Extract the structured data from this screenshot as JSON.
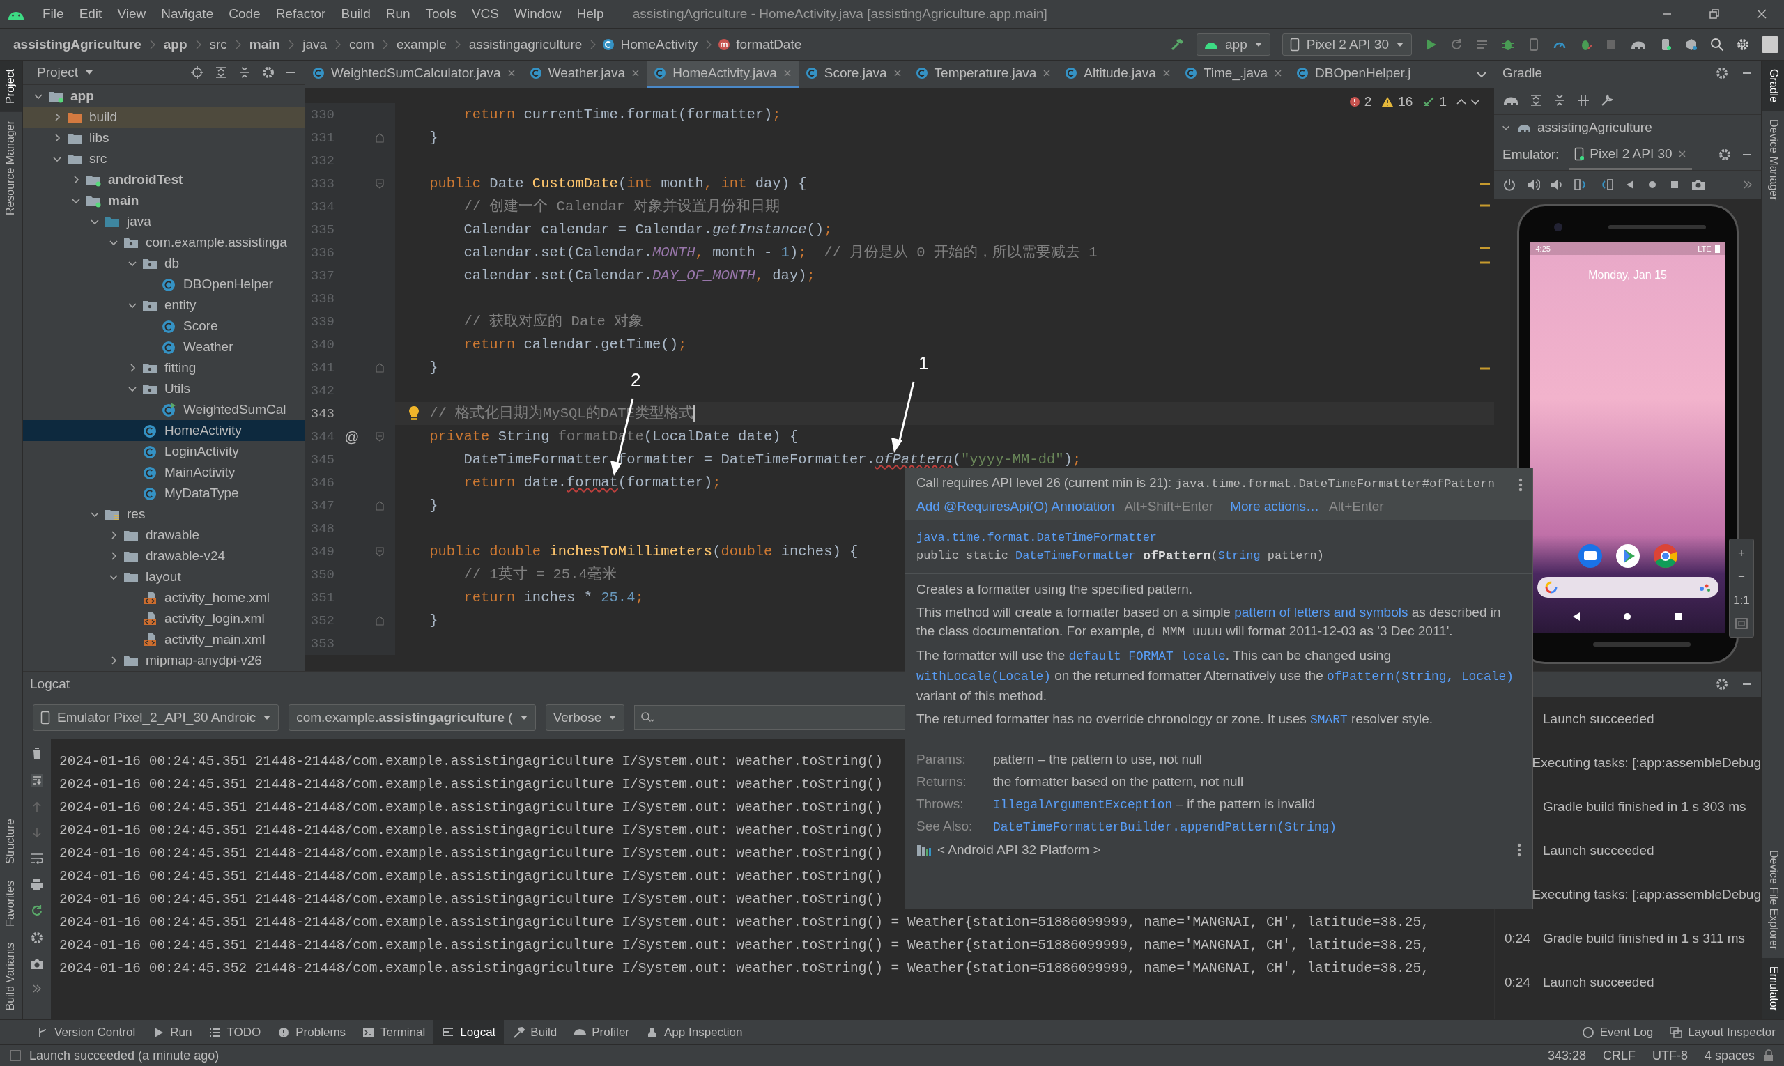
{
  "title_bar": {
    "menus": [
      "File",
      "Edit",
      "View",
      "Navigate",
      "Code",
      "Refactor",
      "Build",
      "Run",
      "Tools",
      "VCS",
      "Window",
      "Help"
    ],
    "title": "assistingAgriculture - HomeActivity.java [assistingAgriculture.app.main]"
  },
  "nav_bar": {
    "breadcrumbs": [
      {
        "label": "assistingAgriculture",
        "bold": true,
        "kind": "plain"
      },
      {
        "label": "app",
        "bold": true,
        "kind": "plain"
      },
      {
        "label": "src",
        "bold": false,
        "kind": "plain"
      },
      {
        "label": "main",
        "bold": true,
        "kind": "plain"
      },
      {
        "label": "java",
        "bold": false,
        "kind": "plain"
      },
      {
        "label": "com",
        "bold": false,
        "kind": "plain"
      },
      {
        "label": "example",
        "bold": false,
        "kind": "plain"
      },
      {
        "label": "assistingagriculture",
        "bold": false,
        "kind": "plain"
      },
      {
        "label": "HomeActivity",
        "bold": false,
        "kind": "class"
      },
      {
        "label": "formatDate",
        "bold": false,
        "kind": "method"
      }
    ],
    "run_config": "app",
    "device": "Pixel 2 API 30"
  },
  "left_strip": {
    "top": [
      {
        "label": "Project",
        "selected": true
      },
      {
        "label": "Resource Manager",
        "selected": false
      }
    ],
    "bottom": [
      {
        "label": "Structure",
        "selected": false
      },
      {
        "label": "Favorites",
        "selected": false
      },
      {
        "label": "Build Variants",
        "selected": false
      }
    ]
  },
  "right_strip": {
    "top": [
      {
        "label": "Gradle",
        "selected": true
      },
      {
        "label": "Device Manager",
        "selected": false
      }
    ],
    "bottom": [
      {
        "label": "Device File Explorer",
        "selected": false
      },
      {
        "label": "Emulator",
        "selected": true
      }
    ]
  },
  "project_panel": {
    "title": "Project",
    "tree": [
      {
        "label": "app",
        "kind": "module",
        "bold": true,
        "expanded": true,
        "selected": false,
        "children": [
          {
            "label": "build",
            "kind": "excluded",
            "bold": false,
            "expanded": false,
            "selected": false
          },
          {
            "label": "libs",
            "kind": "folder",
            "bold": false,
            "expanded": false,
            "selected": false
          },
          {
            "label": "src",
            "kind": "folder",
            "bold": false,
            "expanded": true,
            "selected": false,
            "children": [
              {
                "label": "androidTest",
                "kind": "module",
                "bold": true,
                "expanded": false,
                "selected": false
              },
              {
                "label": "main",
                "kind": "module",
                "bold": true,
                "expanded": true,
                "selected": false,
                "children": [
                  {
                    "label": "java",
                    "kind": "source",
                    "bold": false,
                    "expanded": true,
                    "selected": false,
                    "children": [
                      {
                        "label": "com.example.assistinga",
                        "kind": "package",
                        "bold": false,
                        "expanded": true,
                        "selected": false,
                        "children": [
                          {
                            "label": "db",
                            "kind": "package",
                            "bold": false,
                            "expanded": true,
                            "selected": false,
                            "children": [
                              {
                                "label": "DBOpenHelper",
                                "kind": "class",
                                "bold": false,
                                "selected": false
                              }
                            ]
                          },
                          {
                            "label": "entity",
                            "kind": "package",
                            "bold": false,
                            "expanded": true,
                            "selected": false,
                            "children": [
                              {
                                "label": "Score",
                                "kind": "class",
                                "bold": false,
                                "selected": false
                              },
                              {
                                "label": "Weather",
                                "kind": "class",
                                "bold": false,
                                "selected": false
                              }
                            ]
                          },
                          {
                            "label": "fitting",
                            "kind": "package",
                            "bold": false,
                            "expanded": false,
                            "selected": false
                          },
                          {
                            "label": "Utils",
                            "kind": "package",
                            "bold": false,
                            "expanded": true,
                            "selected": false,
                            "children": [
                              {
                                "label": "WeightedSumCal",
                                "kind": "runnable",
                                "bold": false,
                                "selected": false
                              }
                            ]
                          },
                          {
                            "label": "HomeActivity",
                            "kind": "class",
                            "bold": false,
                            "selected": true
                          },
                          {
                            "label": "LoginActivity",
                            "kind": "class",
                            "bold": false,
                            "selected": false
                          },
                          {
                            "label": "MainActivity",
                            "kind": "class",
                            "bold": false,
                            "selected": false
                          },
                          {
                            "label": "MyDataType",
                            "kind": "class",
                            "bold": false,
                            "selected": false
                          }
                        ]
                      }
                    ]
                  },
                  {
                    "label": "res",
                    "kind": "resources",
                    "bold": false,
                    "expanded": true,
                    "selected": false,
                    "children": [
                      {
                        "label": "drawable",
                        "kind": "folder",
                        "bold": false,
                        "expanded": false,
                        "selected": false
                      },
                      {
                        "label": "drawable-v24",
                        "kind": "folder",
                        "bold": false,
                        "expanded": false,
                        "selected": false
                      },
                      {
                        "label": "layout",
                        "kind": "folder",
                        "bold": false,
                        "expanded": true,
                        "selected": false,
                        "children": [
                          {
                            "label": "activity_home.xml",
                            "kind": "layout",
                            "bold": false,
                            "selected": false
                          },
                          {
                            "label": "activity_login.xml",
                            "kind": "layout",
                            "bold": false,
                            "selected": false
                          },
                          {
                            "label": "activity_main.xml",
                            "kind": "layout",
                            "bold": false,
                            "selected": false
                          }
                        ]
                      },
                      {
                        "label": "mipmap-anydpi-v26",
                        "kind": "folder",
                        "bold": false,
                        "expanded": false,
                        "selected": false
                      }
                    ]
                  }
                ]
              }
            ]
          }
        ]
      }
    ]
  },
  "editor_tabs": [
    {
      "label": "WeightedSumCalculator.java",
      "selected": false,
      "closable": true
    },
    {
      "label": "Weather.java",
      "selected": false,
      "closable": true
    },
    {
      "label": "HomeActivity.java",
      "selected": true,
      "closable": true
    },
    {
      "label": "Score.java",
      "selected": false,
      "closable": true
    },
    {
      "label": "Temperature.java",
      "selected": false,
      "closable": true
    },
    {
      "label": "Altitude.java",
      "selected": false,
      "closable": true
    },
    {
      "label": "Time_.java",
      "selected": false,
      "closable": true
    },
    {
      "label": "DBOpenHelper.j",
      "selected": false,
      "closable": false
    }
  ],
  "inspections": {
    "errors": "2",
    "warnings": "16",
    "weak_warnings": "1"
  },
  "code_lines": [
    {
      "number": "330",
      "kind": "plain",
      "current": false,
      "tokens": [
        {
          "kind": "keyword",
          "text": "        return "
        },
        {
          "kind": "plain",
          "text": "currentTime.format(formatter)"
        },
        {
          "kind": "keyword",
          "text": ";"
        }
      ]
    },
    {
      "number": "331",
      "kind": "block-end",
      "current": false,
      "tokens": [
        {
          "kind": "plain",
          "text": "    }"
        }
      ]
    },
    {
      "number": "332",
      "kind": "plain",
      "current": false
    },
    {
      "number": "333",
      "kind": "block-start",
      "current": false,
      "tokens": [
        {
          "kind": "keyword",
          "text": "    public "
        },
        {
          "kind": "plain",
          "text": "Date "
        },
        {
          "kind": "declaration",
          "text": "CustomDate"
        },
        {
          "kind": "plain",
          "text": "("
        },
        {
          "kind": "keyword",
          "text": "int "
        },
        {
          "kind": "plain",
          "text": "month"
        },
        {
          "kind": "keyword",
          "text": ", int "
        },
        {
          "kind": "plain",
          "text": "day) {"
        }
      ]
    },
    {
      "number": "334",
      "kind": "plain",
      "current": false,
      "tokens": [
        {
          "kind": "comment",
          "text": "        // 创建一个 Calendar 对象并设置月份和日期"
        }
      ]
    },
    {
      "number": "335",
      "kind": "plain",
      "current": false,
      "tokens": [
        {
          "kind": "plain",
          "text": "        Calendar calendar = Calendar."
        },
        {
          "kind": "call",
          "text": "getInstance"
        },
        {
          "kind": "plain",
          "text": "()"
        },
        {
          "kind": "keyword",
          "text": ";"
        }
      ]
    },
    {
      "number": "336",
      "kind": "plain",
      "current": false,
      "tokens": [
        {
          "kind": "plain",
          "text": "        calendar.set(Calendar."
        },
        {
          "kind": "constant",
          "text": "MONTH"
        },
        {
          "kind": "keyword",
          "text": ", "
        },
        {
          "kind": "plain",
          "text": "month - "
        },
        {
          "kind": "number",
          "text": "1"
        },
        {
          "kind": "plain",
          "text": ")"
        },
        {
          "kind": "keyword",
          "text": ";"
        },
        {
          "kind": "comment",
          "text": "  // 月份是从 0 开始的，所以需要减去 1"
        }
      ]
    },
    {
      "number": "337",
      "kind": "plain",
      "current": false,
      "tokens": [
        {
          "kind": "plain",
          "text": "        calendar.set(Calendar."
        },
        {
          "kind": "constant",
          "text": "DAY_OF_MONTH"
        },
        {
          "kind": "keyword",
          "text": ", "
        },
        {
          "kind": "plain",
          "text": "day)"
        },
        {
          "kind": "keyword",
          "text": ";"
        }
      ]
    },
    {
      "number": "338",
      "kind": "plain",
      "current": false
    },
    {
      "number": "339",
      "kind": "plain",
      "current": false,
      "tokens": [
        {
          "kind": "comment",
          "text": "        // 获取对应的 Date 对象"
        }
      ]
    },
    {
      "number": "340",
      "kind": "plain",
      "current": false,
      "tokens": [
        {
          "kind": "keyword",
          "text": "        return "
        },
        {
          "kind": "plain",
          "text": "calendar.getTime()"
        },
        {
          "kind": "keyword",
          "text": ";"
        }
      ]
    },
    {
      "number": "341",
      "kind": "block-end",
      "current": false,
      "tokens": [
        {
          "kind": "plain",
          "text": "    }"
        }
      ]
    },
    {
      "number": "342",
      "kind": "plain",
      "current": false
    },
    {
      "number": "343",
      "kind": "plain",
      "current": true,
      "bulb": true,
      "tokens": [
        {
          "kind": "comment",
          "text": "    // 格式化日期为MySQL的DATE类型格式"
        }
      ]
    },
    {
      "number": "344",
      "kind": "block-start",
      "current": false,
      "gutter_mark": "@",
      "tokens": [
        {
          "kind": "keyword",
          "text": "    private "
        },
        {
          "kind": "plain",
          "text": "String "
        },
        {
          "kind": "unused",
          "text": "formatDate"
        },
        {
          "kind": "plain",
          "text": "(LocalDate date) {"
        }
      ]
    },
    {
      "number": "345",
      "kind": "plain",
      "current": false,
      "tokens": [
        {
          "kind": "plain",
          "text": "        DateTimeFormatter formatter = DateTimeFormatter."
        },
        {
          "kind": "error-call",
          "text": "ofPattern"
        },
        {
          "kind": "plain",
          "text": "("
        },
        {
          "kind": "string",
          "text": "\"yyyy-MM-dd\""
        },
        {
          "kind": "plain",
          "text": ")"
        },
        {
          "kind": "keyword",
          "text": ";"
        }
      ]
    },
    {
      "number": "346",
      "kind": "plain",
      "current": false,
      "tokens": [
        {
          "kind": "keyword",
          "text": "        return "
        },
        {
          "kind": "plain",
          "text": "date."
        },
        {
          "kind": "error",
          "text": "format"
        },
        {
          "kind": "plain",
          "text": "(formatter)"
        },
        {
          "kind": "keyword",
          "text": ";"
        }
      ]
    },
    {
      "number": "347",
      "kind": "block-end",
      "current": false,
      "tokens": [
        {
          "kind": "plain",
          "text": "    }"
        }
      ]
    },
    {
      "number": "348",
      "kind": "plain",
      "current": false
    },
    {
      "number": "349",
      "kind": "block-start",
      "current": false,
      "tokens": [
        {
          "kind": "keyword",
          "text": "    public double "
        },
        {
          "kind": "declaration",
          "text": "inchesToMillimeters"
        },
        {
          "kind": "plain",
          "text": "("
        },
        {
          "kind": "keyword",
          "text": "double "
        },
        {
          "kind": "plain",
          "text": "inches) {"
        }
      ]
    },
    {
      "number": "350",
      "kind": "plain",
      "current": false,
      "tokens": [
        {
          "kind": "comment",
          "text": "        // 1英寸 = 25.4毫米"
        }
      ]
    },
    {
      "number": "351",
      "kind": "plain",
      "current": false,
      "tokens": [
        {
          "kind": "keyword",
          "text": "        return "
        },
        {
          "kind": "plain",
          "text": "inches * "
        },
        {
          "kind": "number",
          "text": "25.4"
        },
        {
          "kind": "keyword",
          "text": ";"
        }
      ]
    },
    {
      "number": "352",
      "kind": "block-end",
      "current": false,
      "tokens": [
        {
          "kind": "plain",
          "text": "    }"
        }
      ]
    },
    {
      "number": "353",
      "kind": "plain",
      "current": false
    }
  ],
  "annotations": [
    {
      "label": "1"
    },
    {
      "label": "2"
    }
  ],
  "tooltip": {
    "problem": [
      {
        "kind": "text",
        "text": "Call requires API level 26 (current min is 21): "
      },
      {
        "kind": "code",
        "text": "java.time.format.DateTimeFormatter#ofPattern"
      }
    ],
    "actions": [
      {
        "label": "Add @RequiresApi(O) Annotation",
        "shortcut": "Alt+Shift+Enter"
      },
      {
        "label": "More actions…",
        "shortcut": "Alt+Enter"
      }
    ],
    "signature": [
      [
        {
          "kind": "linkcode",
          "text": "java.time.format.DateTimeFormatter"
        }
      ],
      [
        {
          "kind": "code",
          "text": "public static "
        },
        {
          "kind": "linkcode",
          "text": "DateTimeFormatter"
        },
        {
          "kind": "boldcode",
          "text": " ofPattern"
        },
        {
          "kind": "code",
          "text": "("
        },
        {
          "kind": "linkcode",
          "text": "String"
        },
        {
          "kind": "code",
          "text": " pattern)"
        }
      ]
    ],
    "paragraphs": [
      [
        {
          "kind": "text",
          "text": "Creates a formatter using the specified pattern."
        }
      ],
      [
        {
          "kind": "text",
          "text": "This method will create a formatter based on a simple "
        },
        {
          "kind": "link",
          "text": "pattern of letters and symbols"
        },
        {
          "kind": "text",
          "text": " as described in the class documentation. For example, "
        },
        {
          "kind": "code",
          "text": "d MMM uuuu"
        },
        {
          "kind": "text",
          "text": " will format 2011-12-03 as '3 Dec 2011'."
        }
      ],
      [
        {
          "kind": "text",
          "text": "The formatter will use the "
        },
        {
          "kind": "linkcode",
          "text": "default FORMAT locale"
        },
        {
          "kind": "text",
          "text": ". This can be changed using "
        },
        {
          "kind": "linkcode",
          "text": "withLocale(Locale)"
        },
        {
          "kind": "text",
          "text": " on the returned formatter Alternatively use the "
        },
        {
          "kind": "linkcode",
          "text": "ofPattern(String, Locale)"
        },
        {
          "kind": "text",
          "text": " variant of this method."
        }
      ],
      [
        {
          "kind": "text",
          "text": "The returned formatter has no override chronology or zone. It uses "
        },
        {
          "kind": "linkcode",
          "text": "SMART"
        },
        {
          "kind": "text",
          "text": " resolver style."
        }
      ]
    ],
    "tags": [
      {
        "label": "Params:",
        "value": [
          {
            "kind": "text",
            "text": "pattern – the pattern to use, not null"
          }
        ]
      },
      {
        "label": "Returns:",
        "value": [
          {
            "kind": "text",
            "text": "the formatter based on the pattern, not null"
          }
        ]
      },
      {
        "label": "Throws:",
        "value": [
          {
            "kind": "linkcode",
            "text": "IllegalArgumentException"
          },
          {
            "kind": "text",
            "text": " – if the pattern is invalid"
          }
        ]
      },
      {
        "label": "See Also:",
        "value": [
          {
            "kind": "linkcode",
            "text": "DateTimeFormatterBuilder.appendPattern(String)"
          }
        ]
      }
    ],
    "source": "< Android API 32 Platform >"
  },
  "gradle_panel": {
    "title": "Gradle",
    "project": "assistingAgriculture"
  },
  "emulator_panel": {
    "label": "Emulator:",
    "device_tab": "Pixel 2 API 30",
    "phone": {
      "time": "4:25",
      "network": "LTE",
      "date": "Monday, Jan 15"
    },
    "zoom_controls": [
      "+",
      "−",
      "1:1"
    ]
  },
  "logcat": {
    "title": "Logcat",
    "device": "Emulator Pixel_2_API_30 Androic",
    "package": "com.example.**assistingagriculture** (",
    "level": "Verbose",
    "rows": [
      "2024-01-16 00:24:45.351 21448-21448/com.example.assistingagriculture I/System.out: weather.toString()",
      "2024-01-16 00:24:45.351 21448-21448/com.example.assistingagriculture I/System.out: weather.toString()",
      "2024-01-16 00:24:45.351 21448-21448/com.example.assistingagriculture I/System.out: weather.toString()",
      "2024-01-16 00:24:45.351 21448-21448/com.example.assistingagriculture I/System.out: weather.toString()",
      "2024-01-16 00:24:45.351 21448-21448/com.example.assistingagriculture I/System.out: weather.toString()",
      "2024-01-16 00:24:45.351 21448-21448/com.example.assistingagriculture I/System.out: weather.toString()",
      "2024-01-16 00:24:45.351 21448-21448/com.example.assistingagriculture I/System.out: weather.toString()",
      "2024-01-16 00:24:45.351 21448-21448/com.example.assistingagriculture I/System.out: weather.toString() = Weather{station=51886099999, name='MANGNAI, CH', latitude=38.25,",
      "2024-01-16 00:24:45.351 21448-21448/com.example.assistingagriculture I/System.out: weather.toString() = Weather{station=51886099999, name='MANGNAI, CH', latitude=38.25,",
      "2024-01-16 00:24:45.352 21448-21448/com.example.assistingagriculture I/System.out: weather.toString() = Weather{station=51886099999, name='MANGNAI, CH', latitude=38.25,"
    ]
  },
  "build_output": [
    {
      "message": "Launch succeeded"
    },
    {
      "message": "Executing tasks: [:app:assembleDebug"
    },
    {
      "message": "Gradle build finished in 1 s 303 ms"
    },
    {
      "message": "Launch succeeded"
    },
    {
      "message": "Executing tasks: [:app:assembleDebug"
    },
    {
      "time": "0:24",
      "message": "Gradle build finished in 1 s 311 ms"
    },
    {
      "time": "0:24",
      "message": "Launch succeeded"
    }
  ],
  "tool_tabs": [
    {
      "label": "Version Control",
      "kind": "branch",
      "selected": false
    },
    {
      "label": "Run",
      "kind": "play",
      "selected": false
    },
    {
      "label": "TODO",
      "kind": "list",
      "selected": false
    },
    {
      "label": "Problems",
      "kind": "info",
      "selected": false
    },
    {
      "label": "Terminal",
      "kind": "terminal",
      "selected": false
    },
    {
      "label": "Logcat",
      "kind": "lines",
      "selected": true
    },
    {
      "label": "Build",
      "kind": "hammer",
      "selected": false
    },
    {
      "label": "Profiler",
      "kind": "gauge",
      "selected": false
    },
    {
      "label": "App Inspection",
      "kind": "probe",
      "selected": false
    }
  ],
  "right_tool_tabs": [
    {
      "label": "Event Log",
      "kind": "bubble"
    },
    {
      "label": "Layout Inspector",
      "kind": "layers"
    }
  ],
  "status_bar": {
    "message": "Launch succeeded (a minute ago)",
    "position": "343:28",
    "line_separator": "CRLF",
    "encoding": "UTF-8",
    "indent": "4 spaces"
  }
}
